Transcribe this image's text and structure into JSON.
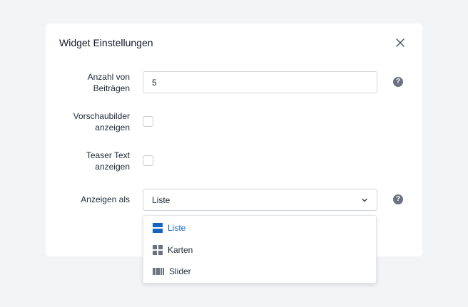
{
  "dialog": {
    "title": "Widget Einstellungen"
  },
  "fields": {
    "count_label_line1": "Anzahl von",
    "count_label_line2": "Beiträgen",
    "count_value": "5",
    "thumbs_label_line1": "Vorschaubilder",
    "thumbs_label_line2": "anzeigen",
    "teaser_label_line1": "Teaser Text",
    "teaser_label_line2": "anzeigen",
    "display_label": "Anzeigen als",
    "display_value": "Liste",
    "help_glyph": "?"
  },
  "dropdown": {
    "options": [
      {
        "label": "Liste",
        "icon": "list-view-icon",
        "selected": true
      },
      {
        "label": "Karten",
        "icon": "grid-view-icon",
        "selected": false
      },
      {
        "label": "Slider",
        "icon": "slider-view-icon",
        "selected": false
      }
    ]
  },
  "colors": {
    "accent": "#1565c0",
    "icon_gray": "#6b7280"
  }
}
